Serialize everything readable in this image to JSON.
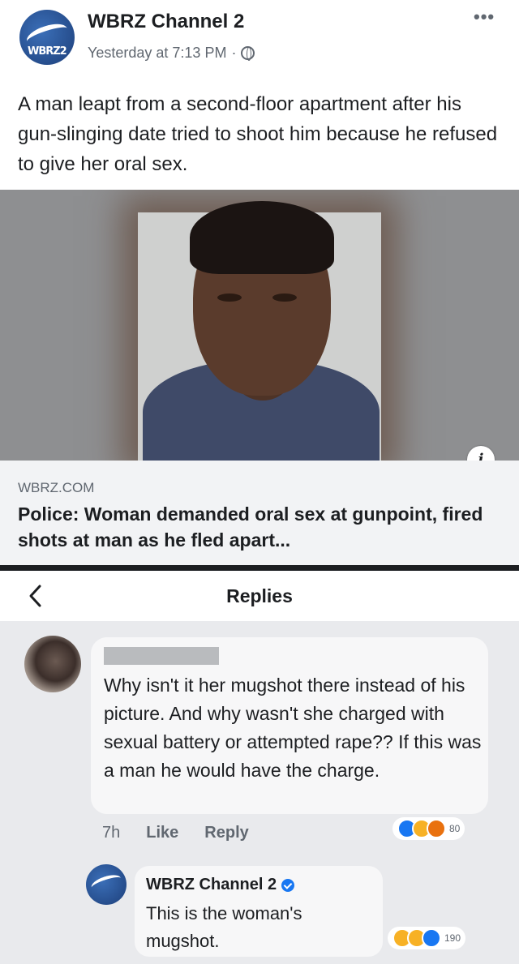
{
  "post": {
    "page_name": "WBRZ Channel 2",
    "timestamp": "Yesterday at 7:13 PM",
    "meta_separator": "·",
    "text": "A man leapt from a second-floor apartment after his gun-slinging date tried to shoot him because he refused to give her oral sex.",
    "more_label": "•••"
  },
  "link": {
    "domain": "WBRZ.COM",
    "title": "Police: Woman demanded oral sex at gunpoint, fired shots at man as he fled apart...",
    "info_label": "i"
  },
  "replies": {
    "header_title": "Replies",
    "comment": {
      "text": "Why isn't it her mugshot there instead of his picture. And why wasn't she charged with sexual battery or attempted rape?? If this was a man he would have the charge.",
      "time": "7h",
      "like_label": "Like",
      "reply_label": "Reply",
      "reaction_count": "80"
    },
    "reply": {
      "author": "WBRZ Channel 2",
      "text": "This is the woman's mugshot.",
      "reaction_count": "190"
    }
  },
  "icons": {
    "page_avatar": "wbrz-logo-icon",
    "globe": "globe-icon",
    "tag": "tag-icon",
    "more": "more-icon",
    "info": "info-icon",
    "back": "back-icon",
    "verified": "verified-icon"
  },
  "colors": {
    "text_primary": "#1c1e21",
    "text_secondary": "#606770",
    "link_meta_bg": "#f2f3f5",
    "replies_bg": "#e9eaed",
    "reaction_like": "#1877f2"
  }
}
